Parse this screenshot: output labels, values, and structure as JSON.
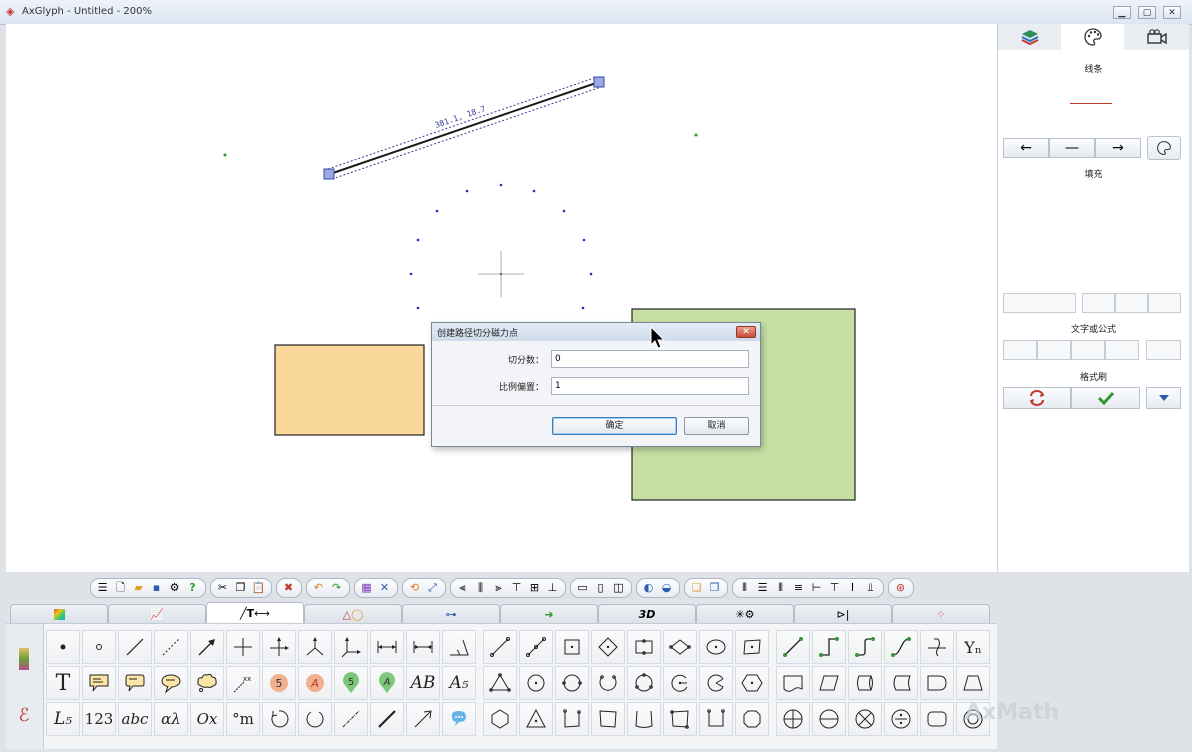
{
  "window": {
    "title": "AxGlyph - Untitled - 200%",
    "minimize": "▭",
    "maximize": "▢",
    "close": "✕"
  },
  "canvas": {
    "measure_label": "381.1, 18.7"
  },
  "right_panel": {
    "tabs": [
      "layers-icon",
      "palette-icon",
      "camera-icon"
    ],
    "line_label": "线条",
    "fill_label": "填充",
    "text_label": "文字或公式",
    "format_brush_label": "格式刷",
    "arrow_buttons": [
      "←",
      "—",
      "→"
    ]
  },
  "dialog": {
    "title": "创建路径切分磁力点",
    "close_label": "✕",
    "field1_label": "切分数：",
    "field1_value": "0",
    "field2_label": "比例偏置：",
    "field2_value": "1",
    "ok_label": "确定",
    "cancel_label": "取消"
  },
  "shape_tabs": [
    "",
    "",
    "T",
    "",
    "",
    "",
    "3D",
    "",
    "",
    ""
  ],
  "palette": {
    "text_cells": [
      "T",
      "AB",
      "A₅",
      "L₅",
      "123",
      "abc",
      "αλ",
      "Ox",
      "°m",
      "Yₙ"
    ],
    "badge_5": "5",
    "badge_A": "A"
  },
  "watermark": "AxMath"
}
